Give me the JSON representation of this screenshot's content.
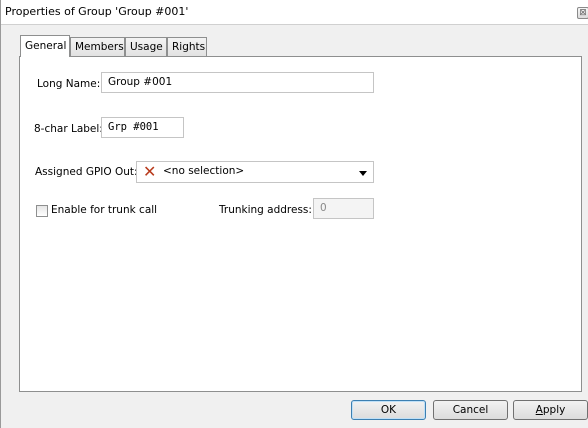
{
  "window": {
    "title": "Properties of Group 'Group #001'",
    "close_glyph": "⊠"
  },
  "tabs": [
    {
      "label": "General",
      "active": true
    },
    {
      "label": "Members",
      "active": false
    },
    {
      "label": "Usage",
      "active": false
    },
    {
      "label": "Rights",
      "active": false
    }
  ],
  "general": {
    "long_name_label": "Long Name:",
    "long_name_value": "Group #001",
    "label8_label": "8-char Label:",
    "label8_value": "Grp #001",
    "gpio_label": "Assigned GPIO Out:",
    "gpio_value": "<no selection>",
    "gpio_icon": "red-x-icon",
    "trunk_label": "Enable for trunk call",
    "trunk_checked": false,
    "trunking_address_label": "Trunking address:",
    "trunking_address_value": "0"
  },
  "buttons": {
    "ok": "OK",
    "cancel": "Cancel",
    "apply_first": "A",
    "apply_rest": "pply"
  },
  "colors": {
    "accent": "#3c7fb1",
    "x_icon": "#b83a1c"
  }
}
